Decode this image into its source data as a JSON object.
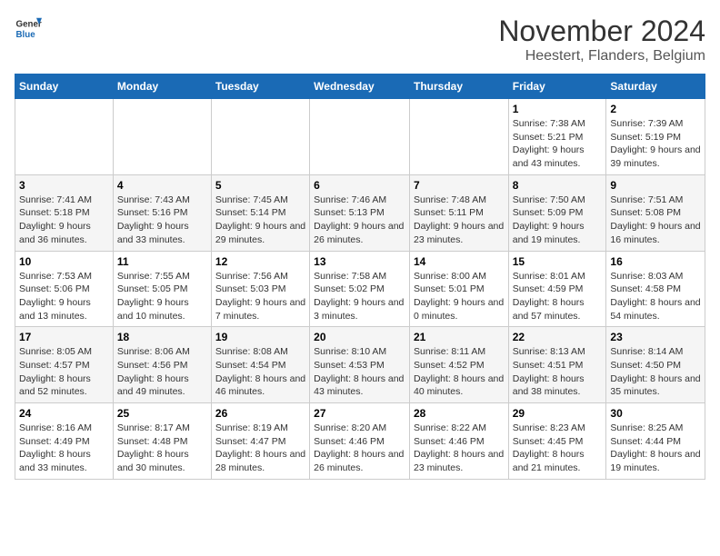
{
  "logo": {
    "line1": "General",
    "line2": "Blue"
  },
  "title": "November 2024",
  "subtitle": "Heestert, Flanders, Belgium",
  "days_of_week": [
    "Sunday",
    "Monday",
    "Tuesday",
    "Wednesday",
    "Thursday",
    "Friday",
    "Saturday"
  ],
  "weeks": [
    [
      {
        "day": "",
        "info": ""
      },
      {
        "day": "",
        "info": ""
      },
      {
        "day": "",
        "info": ""
      },
      {
        "day": "",
        "info": ""
      },
      {
        "day": "",
        "info": ""
      },
      {
        "day": "1",
        "info": "Sunrise: 7:38 AM\nSunset: 5:21 PM\nDaylight: 9 hours and 43 minutes."
      },
      {
        "day": "2",
        "info": "Sunrise: 7:39 AM\nSunset: 5:19 PM\nDaylight: 9 hours and 39 minutes."
      }
    ],
    [
      {
        "day": "3",
        "info": "Sunrise: 7:41 AM\nSunset: 5:18 PM\nDaylight: 9 hours and 36 minutes."
      },
      {
        "day": "4",
        "info": "Sunrise: 7:43 AM\nSunset: 5:16 PM\nDaylight: 9 hours and 33 minutes."
      },
      {
        "day": "5",
        "info": "Sunrise: 7:45 AM\nSunset: 5:14 PM\nDaylight: 9 hours and 29 minutes."
      },
      {
        "day": "6",
        "info": "Sunrise: 7:46 AM\nSunset: 5:13 PM\nDaylight: 9 hours and 26 minutes."
      },
      {
        "day": "7",
        "info": "Sunrise: 7:48 AM\nSunset: 5:11 PM\nDaylight: 9 hours and 23 minutes."
      },
      {
        "day": "8",
        "info": "Sunrise: 7:50 AM\nSunset: 5:09 PM\nDaylight: 9 hours and 19 minutes."
      },
      {
        "day": "9",
        "info": "Sunrise: 7:51 AM\nSunset: 5:08 PM\nDaylight: 9 hours and 16 minutes."
      }
    ],
    [
      {
        "day": "10",
        "info": "Sunrise: 7:53 AM\nSunset: 5:06 PM\nDaylight: 9 hours and 13 minutes."
      },
      {
        "day": "11",
        "info": "Sunrise: 7:55 AM\nSunset: 5:05 PM\nDaylight: 9 hours and 10 minutes."
      },
      {
        "day": "12",
        "info": "Sunrise: 7:56 AM\nSunset: 5:03 PM\nDaylight: 9 hours and 7 minutes."
      },
      {
        "day": "13",
        "info": "Sunrise: 7:58 AM\nSunset: 5:02 PM\nDaylight: 9 hours and 3 minutes."
      },
      {
        "day": "14",
        "info": "Sunrise: 8:00 AM\nSunset: 5:01 PM\nDaylight: 9 hours and 0 minutes."
      },
      {
        "day": "15",
        "info": "Sunrise: 8:01 AM\nSunset: 4:59 PM\nDaylight: 8 hours and 57 minutes."
      },
      {
        "day": "16",
        "info": "Sunrise: 8:03 AM\nSunset: 4:58 PM\nDaylight: 8 hours and 54 minutes."
      }
    ],
    [
      {
        "day": "17",
        "info": "Sunrise: 8:05 AM\nSunset: 4:57 PM\nDaylight: 8 hours and 52 minutes."
      },
      {
        "day": "18",
        "info": "Sunrise: 8:06 AM\nSunset: 4:56 PM\nDaylight: 8 hours and 49 minutes."
      },
      {
        "day": "19",
        "info": "Sunrise: 8:08 AM\nSunset: 4:54 PM\nDaylight: 8 hours and 46 minutes."
      },
      {
        "day": "20",
        "info": "Sunrise: 8:10 AM\nSunset: 4:53 PM\nDaylight: 8 hours and 43 minutes."
      },
      {
        "day": "21",
        "info": "Sunrise: 8:11 AM\nSunset: 4:52 PM\nDaylight: 8 hours and 40 minutes."
      },
      {
        "day": "22",
        "info": "Sunrise: 8:13 AM\nSunset: 4:51 PM\nDaylight: 8 hours and 38 minutes."
      },
      {
        "day": "23",
        "info": "Sunrise: 8:14 AM\nSunset: 4:50 PM\nDaylight: 8 hours and 35 minutes."
      }
    ],
    [
      {
        "day": "24",
        "info": "Sunrise: 8:16 AM\nSunset: 4:49 PM\nDaylight: 8 hours and 33 minutes."
      },
      {
        "day": "25",
        "info": "Sunrise: 8:17 AM\nSunset: 4:48 PM\nDaylight: 8 hours and 30 minutes."
      },
      {
        "day": "26",
        "info": "Sunrise: 8:19 AM\nSunset: 4:47 PM\nDaylight: 8 hours and 28 minutes."
      },
      {
        "day": "27",
        "info": "Sunrise: 8:20 AM\nSunset: 4:46 PM\nDaylight: 8 hours and 26 minutes."
      },
      {
        "day": "28",
        "info": "Sunrise: 8:22 AM\nSunset: 4:46 PM\nDaylight: 8 hours and 23 minutes."
      },
      {
        "day": "29",
        "info": "Sunrise: 8:23 AM\nSunset: 4:45 PM\nDaylight: 8 hours and 21 minutes."
      },
      {
        "day": "30",
        "info": "Sunrise: 8:25 AM\nSunset: 4:44 PM\nDaylight: 8 hours and 19 minutes."
      }
    ]
  ]
}
